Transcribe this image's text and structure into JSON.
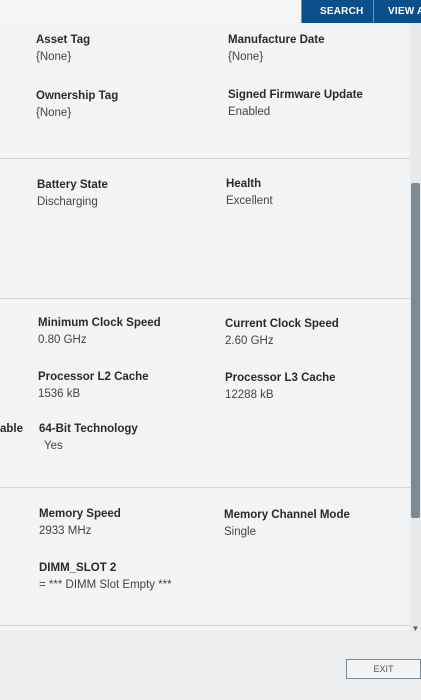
{
  "topbar": {
    "search_label": "SEARCH",
    "view_all_label": "VIEW AL"
  },
  "system": {
    "asset_tag": {
      "label": "Asset Tag",
      "value": "{None}"
    },
    "manufacture_date": {
      "label": "Manufacture Date",
      "value": "{None}"
    },
    "ownership_tag": {
      "label": "Ownership Tag",
      "value": "{None}"
    },
    "signed_firmware_update": {
      "label": "Signed Firmware Update",
      "value": "Enabled"
    }
  },
  "battery": {
    "state": {
      "label": "Battery State",
      "value": "Discharging"
    },
    "health": {
      "label": "Health",
      "value": "Excellent"
    }
  },
  "processor": {
    "min_clock": {
      "label": "Minimum Clock Speed",
      "value": "0.80 GHz"
    },
    "current_clock": {
      "label": "Current Clock Speed",
      "value": "2.60 GHz"
    },
    "l2_cache": {
      "label": "Processor L2 Cache",
      "value": "1536 kB"
    },
    "l3_cache": {
      "label": "Processor L3 Cache",
      "value": "12288 kB"
    },
    "cut_label": "able",
    "bit64": {
      "label": "64-Bit Technology",
      "value": "Yes"
    }
  },
  "memory": {
    "speed": {
      "label": "Memory Speed",
      "value": "2933 MHz"
    },
    "channel_mode": {
      "label": "Memory Channel Mode",
      "value": "Single"
    },
    "dimm_slot_2": {
      "label": "DIMM_SLOT 2",
      "value": "= *** DIMM Slot Empty ***"
    }
  },
  "footer": {
    "exit_label": "EXIT"
  }
}
